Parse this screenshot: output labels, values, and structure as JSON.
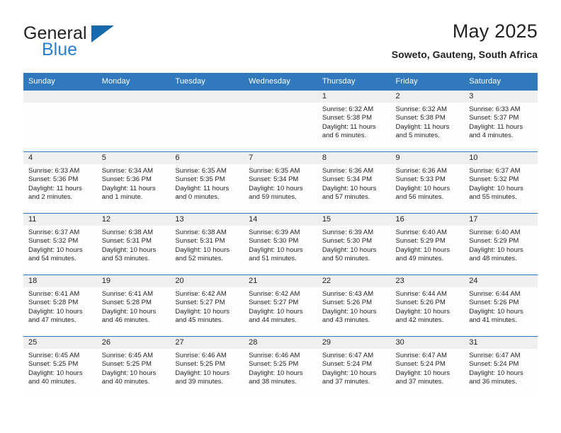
{
  "brand": {
    "name_part1": "General",
    "name_part2": "Blue",
    "logo_icon": "triangle-logo-icon"
  },
  "header": {
    "month_title": "May 2025",
    "location": "Soweto, Gauteng, South Africa"
  },
  "colors": {
    "header_blue": "#3079bd",
    "brand_blue": "#2980d0",
    "logo_blue": "#1769ac",
    "daynum_band": "#efefef",
    "text": "#231f20"
  },
  "weekday_headers": [
    "Sunday",
    "Monday",
    "Tuesday",
    "Wednesday",
    "Thursday",
    "Friday",
    "Saturday"
  ],
  "labels": {
    "sunrise_prefix": "Sunrise:",
    "sunset_prefix": "Sunset:",
    "daylight_prefix": "Daylight:"
  },
  "weeks": [
    [
      {
        "day": "",
        "empty": true,
        "sunrise": "",
        "sunset": "",
        "daylight_line1": "",
        "daylight_line2": ""
      },
      {
        "day": "",
        "empty": true,
        "sunrise": "",
        "sunset": "",
        "daylight_line1": "",
        "daylight_line2": ""
      },
      {
        "day": "",
        "empty": true,
        "sunrise": "",
        "sunset": "",
        "daylight_line1": "",
        "daylight_line2": ""
      },
      {
        "day": "",
        "empty": true,
        "sunrise": "",
        "sunset": "",
        "daylight_line1": "",
        "daylight_line2": ""
      },
      {
        "day": "1",
        "empty": false,
        "sunrise": "Sunrise: 6:32 AM",
        "sunset": "Sunset: 5:38 PM",
        "daylight_line1": "Daylight: 11 hours",
        "daylight_line2": "and 6 minutes."
      },
      {
        "day": "2",
        "empty": false,
        "sunrise": "Sunrise: 6:32 AM",
        "sunset": "Sunset: 5:38 PM",
        "daylight_line1": "Daylight: 11 hours",
        "daylight_line2": "and 5 minutes."
      },
      {
        "day": "3",
        "empty": false,
        "sunrise": "Sunrise: 6:33 AM",
        "sunset": "Sunset: 5:37 PM",
        "daylight_line1": "Daylight: 11 hours",
        "daylight_line2": "and 4 minutes."
      }
    ],
    [
      {
        "day": "4",
        "empty": false,
        "sunrise": "Sunrise: 6:33 AM",
        "sunset": "Sunset: 5:36 PM",
        "daylight_line1": "Daylight: 11 hours",
        "daylight_line2": "and 2 minutes."
      },
      {
        "day": "5",
        "empty": false,
        "sunrise": "Sunrise: 6:34 AM",
        "sunset": "Sunset: 5:36 PM",
        "daylight_line1": "Daylight: 11 hours",
        "daylight_line2": "and 1 minute."
      },
      {
        "day": "6",
        "empty": false,
        "sunrise": "Sunrise: 6:35 AM",
        "sunset": "Sunset: 5:35 PM",
        "daylight_line1": "Daylight: 11 hours",
        "daylight_line2": "and 0 minutes."
      },
      {
        "day": "7",
        "empty": false,
        "sunrise": "Sunrise: 6:35 AM",
        "sunset": "Sunset: 5:34 PM",
        "daylight_line1": "Daylight: 10 hours",
        "daylight_line2": "and 59 minutes."
      },
      {
        "day": "8",
        "empty": false,
        "sunrise": "Sunrise: 6:36 AM",
        "sunset": "Sunset: 5:34 PM",
        "daylight_line1": "Daylight: 10 hours",
        "daylight_line2": "and 57 minutes."
      },
      {
        "day": "9",
        "empty": false,
        "sunrise": "Sunrise: 6:36 AM",
        "sunset": "Sunset: 5:33 PM",
        "daylight_line1": "Daylight: 10 hours",
        "daylight_line2": "and 56 minutes."
      },
      {
        "day": "10",
        "empty": false,
        "sunrise": "Sunrise: 6:37 AM",
        "sunset": "Sunset: 5:32 PM",
        "daylight_line1": "Daylight: 10 hours",
        "daylight_line2": "and 55 minutes."
      }
    ],
    [
      {
        "day": "11",
        "empty": false,
        "sunrise": "Sunrise: 6:37 AM",
        "sunset": "Sunset: 5:32 PM",
        "daylight_line1": "Daylight: 10 hours",
        "daylight_line2": "and 54 minutes."
      },
      {
        "day": "12",
        "empty": false,
        "sunrise": "Sunrise: 6:38 AM",
        "sunset": "Sunset: 5:31 PM",
        "daylight_line1": "Daylight: 10 hours",
        "daylight_line2": "and 53 minutes."
      },
      {
        "day": "13",
        "empty": false,
        "sunrise": "Sunrise: 6:38 AM",
        "sunset": "Sunset: 5:31 PM",
        "daylight_line1": "Daylight: 10 hours",
        "daylight_line2": "and 52 minutes."
      },
      {
        "day": "14",
        "empty": false,
        "sunrise": "Sunrise: 6:39 AM",
        "sunset": "Sunset: 5:30 PM",
        "daylight_line1": "Daylight: 10 hours",
        "daylight_line2": "and 51 minutes."
      },
      {
        "day": "15",
        "empty": false,
        "sunrise": "Sunrise: 6:39 AM",
        "sunset": "Sunset: 5:30 PM",
        "daylight_line1": "Daylight: 10 hours",
        "daylight_line2": "and 50 minutes."
      },
      {
        "day": "16",
        "empty": false,
        "sunrise": "Sunrise: 6:40 AM",
        "sunset": "Sunset: 5:29 PM",
        "daylight_line1": "Daylight: 10 hours",
        "daylight_line2": "and 49 minutes."
      },
      {
        "day": "17",
        "empty": false,
        "sunrise": "Sunrise: 6:40 AM",
        "sunset": "Sunset: 5:29 PM",
        "daylight_line1": "Daylight: 10 hours",
        "daylight_line2": "and 48 minutes."
      }
    ],
    [
      {
        "day": "18",
        "empty": false,
        "sunrise": "Sunrise: 6:41 AM",
        "sunset": "Sunset: 5:28 PM",
        "daylight_line1": "Daylight: 10 hours",
        "daylight_line2": "and 47 minutes."
      },
      {
        "day": "19",
        "empty": false,
        "sunrise": "Sunrise: 6:41 AM",
        "sunset": "Sunset: 5:28 PM",
        "daylight_line1": "Daylight: 10 hours",
        "daylight_line2": "and 46 minutes."
      },
      {
        "day": "20",
        "empty": false,
        "sunrise": "Sunrise: 6:42 AM",
        "sunset": "Sunset: 5:27 PM",
        "daylight_line1": "Daylight: 10 hours",
        "daylight_line2": "and 45 minutes."
      },
      {
        "day": "21",
        "empty": false,
        "sunrise": "Sunrise: 6:42 AM",
        "sunset": "Sunset: 5:27 PM",
        "daylight_line1": "Daylight: 10 hours",
        "daylight_line2": "and 44 minutes."
      },
      {
        "day": "22",
        "empty": false,
        "sunrise": "Sunrise: 6:43 AM",
        "sunset": "Sunset: 5:26 PM",
        "daylight_line1": "Daylight: 10 hours",
        "daylight_line2": "and 43 minutes."
      },
      {
        "day": "23",
        "empty": false,
        "sunrise": "Sunrise: 6:44 AM",
        "sunset": "Sunset: 5:26 PM",
        "daylight_line1": "Daylight: 10 hours",
        "daylight_line2": "and 42 minutes."
      },
      {
        "day": "24",
        "empty": false,
        "sunrise": "Sunrise: 6:44 AM",
        "sunset": "Sunset: 5:26 PM",
        "daylight_line1": "Daylight: 10 hours",
        "daylight_line2": "and 41 minutes."
      }
    ],
    [
      {
        "day": "25",
        "empty": false,
        "sunrise": "Sunrise: 6:45 AM",
        "sunset": "Sunset: 5:25 PM",
        "daylight_line1": "Daylight: 10 hours",
        "daylight_line2": "and 40 minutes."
      },
      {
        "day": "26",
        "empty": false,
        "sunrise": "Sunrise: 6:45 AM",
        "sunset": "Sunset: 5:25 PM",
        "daylight_line1": "Daylight: 10 hours",
        "daylight_line2": "and 40 minutes."
      },
      {
        "day": "27",
        "empty": false,
        "sunrise": "Sunrise: 6:46 AM",
        "sunset": "Sunset: 5:25 PM",
        "daylight_line1": "Daylight: 10 hours",
        "daylight_line2": "and 39 minutes."
      },
      {
        "day": "28",
        "empty": false,
        "sunrise": "Sunrise: 6:46 AM",
        "sunset": "Sunset: 5:25 PM",
        "daylight_line1": "Daylight: 10 hours",
        "daylight_line2": "and 38 minutes."
      },
      {
        "day": "29",
        "empty": false,
        "sunrise": "Sunrise: 6:47 AM",
        "sunset": "Sunset: 5:24 PM",
        "daylight_line1": "Daylight: 10 hours",
        "daylight_line2": "and 37 minutes."
      },
      {
        "day": "30",
        "empty": false,
        "sunrise": "Sunrise: 6:47 AM",
        "sunset": "Sunset: 5:24 PM",
        "daylight_line1": "Daylight: 10 hours",
        "daylight_line2": "and 37 minutes."
      },
      {
        "day": "31",
        "empty": false,
        "sunrise": "Sunrise: 6:47 AM",
        "sunset": "Sunset: 5:24 PM",
        "daylight_line1": "Daylight: 10 hours",
        "daylight_line2": "and 36 minutes."
      }
    ]
  ]
}
